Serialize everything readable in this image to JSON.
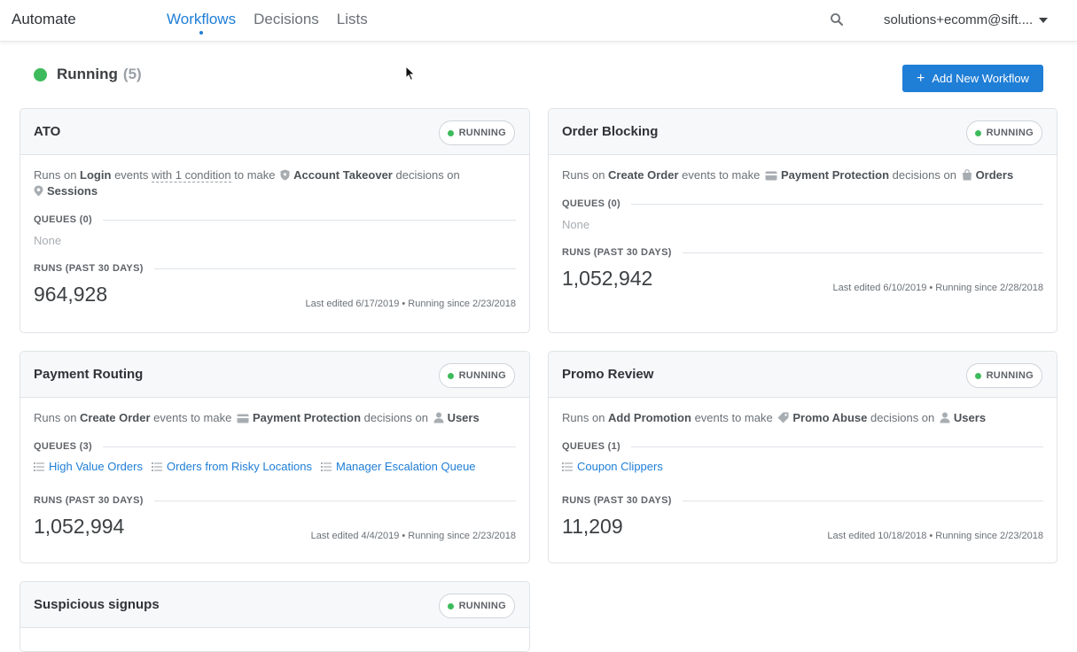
{
  "app": {
    "brand": "Automate"
  },
  "nav": {
    "workflows": "Workflows",
    "decisions": "Decisions",
    "lists": "Lists"
  },
  "account": {
    "email": "solutions+ecomm@sift...."
  },
  "header": {
    "status_title": "Running",
    "status_count": "(5)",
    "add_button": "Add New Workflow"
  },
  "colors": {
    "accent": "#1f7ed6",
    "running": "#3dbb5c"
  },
  "cards": [
    {
      "title": "ATO",
      "badge": "RUNNING",
      "runs_on": "Runs on",
      "event": "Login",
      "events_word": "events",
      "with_condition": "with 1 condition",
      "to_make": "to make",
      "decision": "Account Takeover",
      "decisions_on": "decisions on",
      "entity": "Sessions",
      "queues_label": "QUEUES (0)",
      "queues_none": "None",
      "runs_label": "RUNS (PAST 30 DAYS)",
      "runs": "964,928",
      "meta": "Last edited 6/17/2019 • Running since 2/23/2018"
    },
    {
      "title": "Order Blocking",
      "badge": "RUNNING",
      "runs_on": "Runs on",
      "event": "Create Order",
      "events_word": "events to make",
      "decision": "Payment Protection",
      "decisions_on": "decisions on",
      "entity": "Orders",
      "queues_label": "QUEUES (0)",
      "queues_none": "None",
      "runs_label": "RUNS (PAST 30 DAYS)",
      "runs": "1,052,942",
      "meta": "Last edited 6/10/2019 • Running since 2/28/2018"
    },
    {
      "title": "Payment Routing",
      "badge": "RUNNING",
      "runs_on": "Runs on",
      "event": "Create Order",
      "events_word": "events to make",
      "decision": "Payment Protection",
      "decisions_on": "decisions on",
      "entity": "Users",
      "queues_label": "QUEUES (3)",
      "queues": [
        "High Value Orders",
        "Orders from Risky Locations",
        "Manager Escalation Queue"
      ],
      "runs_label": "RUNS (PAST 30 DAYS)",
      "runs": "1,052,994",
      "meta": "Last edited 4/4/2019 • Running since 2/23/2018"
    },
    {
      "title": "Promo Review",
      "badge": "RUNNING",
      "runs_on": "Runs on",
      "event": "Add Promotion",
      "events_word": "events to make",
      "decision": "Promo Abuse",
      "decisions_on": "decisions on",
      "entity": "Users",
      "queues_label": "QUEUES (1)",
      "queues": [
        "Coupon Clippers"
      ],
      "runs_label": "RUNS (PAST 30 DAYS)",
      "runs": "11,209",
      "meta": "Last edited 10/18/2018 • Running since 2/23/2018"
    },
    {
      "title": "Suspicious signups",
      "badge": "RUNNING"
    }
  ]
}
